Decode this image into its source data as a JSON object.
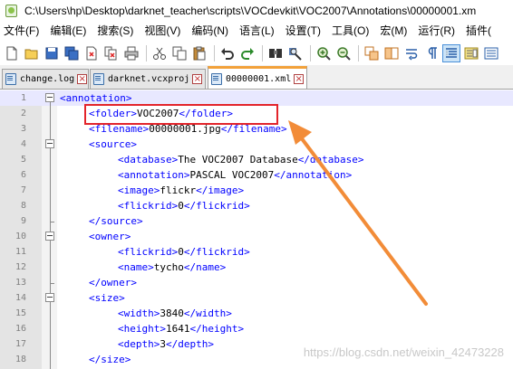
{
  "window": {
    "title": "C:\\Users\\hp\\Desktop\\darknet_teacher\\scripts\\VOCdevkit\\VOC2007\\Annotations\\00000001.xm"
  },
  "menu": [
    {
      "label": "文件(F)"
    },
    {
      "label": "编辑(E)"
    },
    {
      "label": "搜索(S)"
    },
    {
      "label": "视图(V)"
    },
    {
      "label": "编码(N)"
    },
    {
      "label": "语言(L)"
    },
    {
      "label": "设置(T)"
    },
    {
      "label": "工具(O)"
    },
    {
      "label": "宏(M)"
    },
    {
      "label": "运行(R)"
    },
    {
      "label": "插件("
    }
  ],
  "toolbar": {
    "icons": [
      "new-file-icon",
      "open-file-icon",
      "save-icon",
      "save-all-icon",
      "close-icon",
      "close-all-icon",
      "print-icon",
      "cut-icon",
      "copy-icon",
      "paste-icon",
      "undo-icon",
      "redo-icon",
      "find-icon",
      "replace-icon",
      "zoom-in-icon",
      "zoom-out-icon",
      "sync-v-icon",
      "sync-h-icon",
      "word-wrap-icon",
      "show-all-chars-icon",
      "indent-guide-icon",
      "doc-map-icon",
      "function-list-icon"
    ]
  },
  "tabs": [
    {
      "label": "change.log",
      "active": false
    },
    {
      "label": "darknet.vcxproj",
      "active": false
    },
    {
      "label": "00000001.xml",
      "active": true
    }
  ],
  "editor": {
    "lines": [
      {
        "n": "1",
        "indent": 0,
        "open": "<annotation>",
        "text": "",
        "close": ""
      },
      {
        "n": "2",
        "indent": 1,
        "open": "<folder>",
        "text": "VOC2007",
        "close": "</folder>"
      },
      {
        "n": "3",
        "indent": 1,
        "open": "<filename>",
        "text": "00000001.jpg",
        "close": "</filename>"
      },
      {
        "n": "4",
        "indent": 1,
        "open": "<source>",
        "text": "",
        "close": ""
      },
      {
        "n": "5",
        "indent": 2,
        "open": "<database>",
        "text": "The VOC2007 Database",
        "close": "</database>"
      },
      {
        "n": "6",
        "indent": 2,
        "open": "<annotation>",
        "text": "PASCAL VOC2007",
        "close": "</annotation>"
      },
      {
        "n": "7",
        "indent": 2,
        "open": "<image>",
        "text": "flickr",
        "close": "</image>"
      },
      {
        "n": "8",
        "indent": 2,
        "open": "<flickrid>",
        "text": "0",
        "close": "</flickrid>"
      },
      {
        "n": "9",
        "indent": 1,
        "open": "</source>",
        "text": "",
        "close": ""
      },
      {
        "n": "10",
        "indent": 1,
        "open": "<owner>",
        "text": "",
        "close": ""
      },
      {
        "n": "11",
        "indent": 2,
        "open": "<flickrid>",
        "text": "0",
        "close": "</flickrid>"
      },
      {
        "n": "12",
        "indent": 2,
        "open": "<name>",
        "text": "tycho",
        "close": "</name>"
      },
      {
        "n": "13",
        "indent": 1,
        "open": "</owner>",
        "text": "",
        "close": ""
      },
      {
        "n": "14",
        "indent": 1,
        "open": "<size>",
        "text": "",
        "close": ""
      },
      {
        "n": "15",
        "indent": 2,
        "open": "<width>",
        "text": "3840",
        "close": "</width>"
      },
      {
        "n": "16",
        "indent": 2,
        "open": "<height>",
        "text": "1641",
        "close": "</height>"
      },
      {
        "n": "17",
        "indent": 2,
        "open": "<depth>",
        "text": "3",
        "close": "</depth>"
      },
      {
        "n": "18",
        "indent": 1,
        "open": "</size>",
        "text": "",
        "close": ""
      }
    ]
  },
  "watermark": "https://blog.csdn.net/weixin_42473228",
  "colors": {
    "tag": "#0000ff",
    "highlight": "#e3242b",
    "arrow": "#f28c38",
    "active_tab_accent": "#f2a13a"
  }
}
